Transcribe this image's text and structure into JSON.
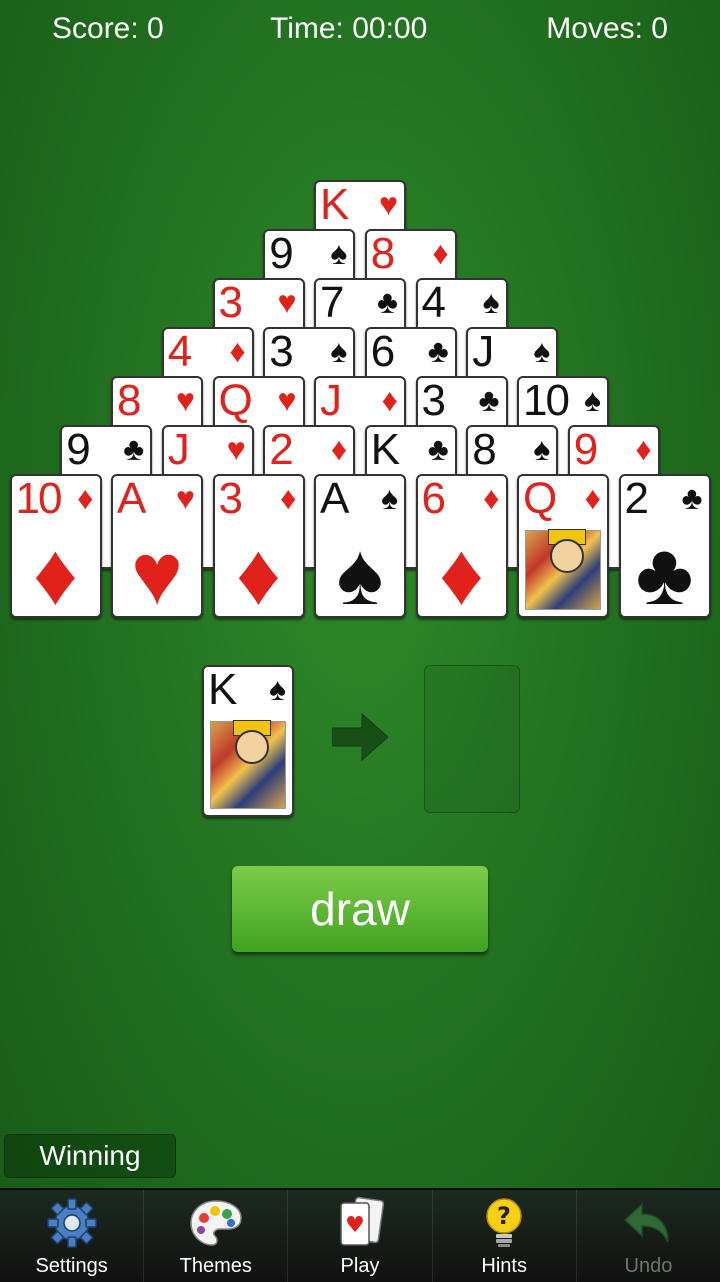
{
  "hud": {
    "score": "Score: 0",
    "time": "Time: 00:00",
    "moves": "Moves: 0"
  },
  "pyramid": [
    [
      {
        "rank": "K",
        "suit": "♥",
        "color": "red"
      }
    ],
    [
      {
        "rank": "9",
        "suit": "♠",
        "color": "black"
      },
      {
        "rank": "8",
        "suit": "♦",
        "color": "red"
      }
    ],
    [
      {
        "rank": "3",
        "suit": "♥",
        "color": "red"
      },
      {
        "rank": "7",
        "suit": "♣",
        "color": "black"
      },
      {
        "rank": "4",
        "suit": "♠",
        "color": "black"
      }
    ],
    [
      {
        "rank": "4",
        "suit": "♦",
        "color": "red"
      },
      {
        "rank": "3",
        "suit": "♠",
        "color": "black"
      },
      {
        "rank": "6",
        "suit": "♣",
        "color": "black"
      },
      {
        "rank": "J",
        "suit": "♠",
        "color": "black"
      }
    ],
    [
      {
        "rank": "8",
        "suit": "♥",
        "color": "red"
      },
      {
        "rank": "Q",
        "suit": "♥",
        "color": "red"
      },
      {
        "rank": "J",
        "suit": "♦",
        "color": "red"
      },
      {
        "rank": "3",
        "suit": "♣",
        "color": "black"
      },
      {
        "rank": "10",
        "suit": "♠",
        "color": "black"
      }
    ],
    [
      {
        "rank": "9",
        "suit": "♣",
        "color": "black"
      },
      {
        "rank": "J",
        "suit": "♥",
        "color": "red"
      },
      {
        "rank": "2",
        "suit": "♦",
        "color": "red"
      },
      {
        "rank": "K",
        "suit": "♣",
        "color": "black"
      },
      {
        "rank": "8",
        "suit": "♠",
        "color": "black"
      },
      {
        "rank": "9",
        "suit": "♦",
        "color": "red"
      }
    ],
    [
      {
        "rank": "10",
        "suit": "♦",
        "color": "red",
        "face": false
      },
      {
        "rank": "A",
        "suit": "♥",
        "color": "red",
        "face": false
      },
      {
        "rank": "3",
        "suit": "♦",
        "color": "red",
        "face": false
      },
      {
        "rank": "A",
        "suit": "♠",
        "color": "black",
        "face": false
      },
      {
        "rank": "6",
        "suit": "♦",
        "color": "red",
        "face": false
      },
      {
        "rank": "Q",
        "suit": "♦",
        "color": "red",
        "face": true
      },
      {
        "rank": "2",
        "suit": "♣",
        "color": "black",
        "face": false
      }
    ]
  ],
  "stock": {
    "rank": "K",
    "suit": "♠",
    "color": "black",
    "face": true
  },
  "draw_label": "draw",
  "winning_label": "Winning",
  "nav": [
    {
      "id": "settings",
      "label": "Settings",
      "icon": "gear-icon",
      "enabled": true
    },
    {
      "id": "themes",
      "label": "Themes",
      "icon": "palette-icon",
      "enabled": true
    },
    {
      "id": "play",
      "label": "Play",
      "icon": "cards-icon",
      "enabled": true
    },
    {
      "id": "hints",
      "label": "Hints",
      "icon": "lightbulb-icon",
      "enabled": true
    },
    {
      "id": "undo",
      "label": "Undo",
      "icon": "undo-arrow-icon",
      "enabled": false
    }
  ]
}
